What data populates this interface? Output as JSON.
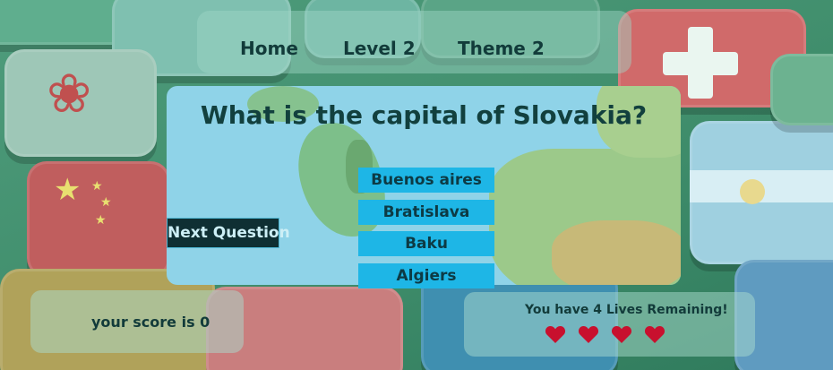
{
  "nav": {
    "items": [
      {
        "label": "Home"
      },
      {
        "label": "Level 2"
      },
      {
        "label": "Theme 2"
      }
    ]
  },
  "quiz": {
    "question": "What is the capital of Slovakia?",
    "answers": [
      "Buenos aires",
      "Bratislava",
      "Baku",
      "Algiers"
    ],
    "next_label": "Next Question"
  },
  "score": {
    "text": "your score is 0",
    "value": 0
  },
  "lives": {
    "text": "You have 4 Lives Remaining!",
    "count": 4,
    "heart_icon": "heart-icon"
  },
  "colors": {
    "answer_button": "#1eb6e6",
    "next_button": "#0f2f33",
    "heart": "#c8102e",
    "text_dark": "#123b3a"
  }
}
